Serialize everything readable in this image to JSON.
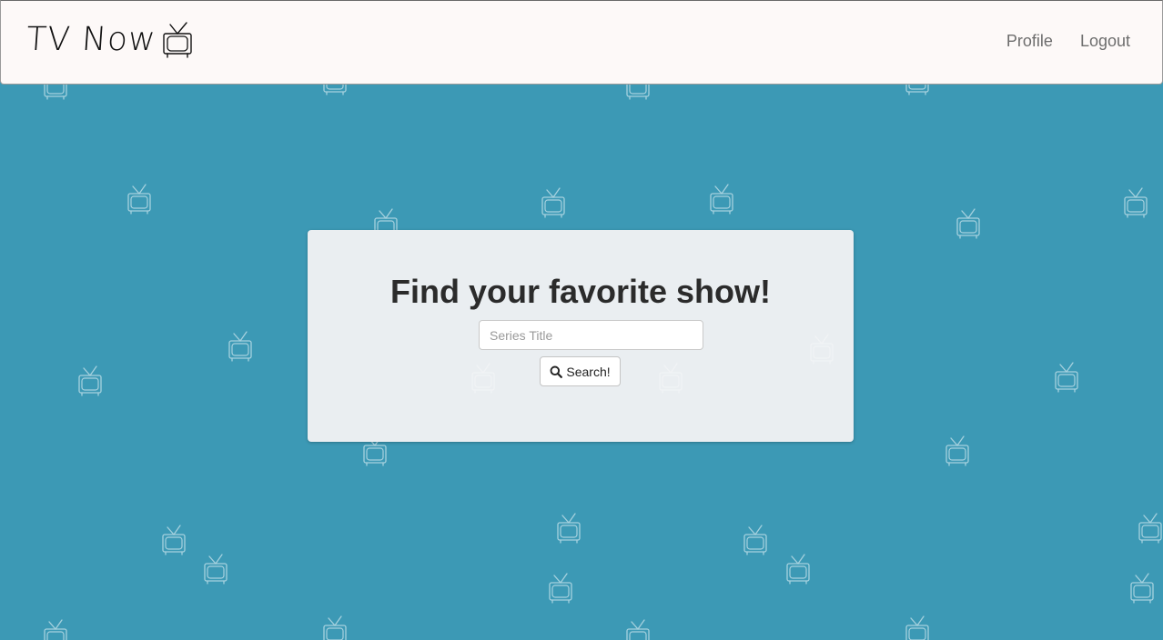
{
  "navbar": {
    "brand_text": "TV Now",
    "brand_icon": "tv-icon",
    "links": [
      {
        "label": "Profile"
      },
      {
        "label": "Logout"
      }
    ]
  },
  "search_card": {
    "title": "Find your favorite show!",
    "input_placeholder": "Series Title",
    "input_value": "",
    "button_label": "Search!",
    "button_icon": "search-icon"
  },
  "background": {
    "color": "#3c99b5",
    "pattern_icon": "tv-icon"
  }
}
